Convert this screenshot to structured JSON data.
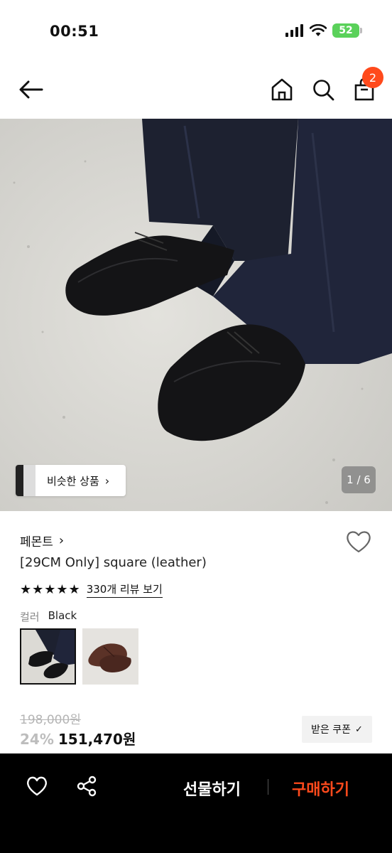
{
  "status_bar": {
    "time": "00:51",
    "battery": "52"
  },
  "nav": {
    "cart_count": "2"
  },
  "hero": {
    "similar_label": "비슷한 상품",
    "page_indicator": "1 / 6"
  },
  "product": {
    "brand": "페몬트",
    "name": "[29CM Only] square (leather)",
    "rating_stars": 5,
    "reviews_label": "330개 리뷰 보기",
    "color_label": "컬러",
    "color_value": "Black",
    "original_price": "198,000원",
    "discount": "24%",
    "price": "151,470원",
    "coupon_label": "받은 쿠폰"
  },
  "bottom_bar": {
    "gift_label": "선물하기",
    "buy_label": "구매하기"
  },
  "colors": {
    "accent": "#ff4a1c",
    "bar_bg": "#000000",
    "battery": "#5ad15a"
  }
}
